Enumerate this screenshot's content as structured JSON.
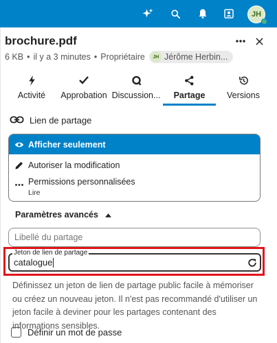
{
  "header": {
    "avatar_initials": "JH",
    "icons": [
      "sparkle-icon",
      "search-icon",
      "bell-icon",
      "contacts-icon"
    ]
  },
  "file": {
    "name": "brochure.pdf",
    "size": "6 KB",
    "modified": "il y a 3 minutes",
    "role": "Propriétaire",
    "owner_initials": "JH",
    "owner_name": "Jérôme Herbin..."
  },
  "tabs": [
    {
      "label": "Activité",
      "icon": "bolt-icon",
      "active": false
    },
    {
      "label": "Approbation",
      "icon": "check-icon",
      "active": false
    },
    {
      "label": "Discussion...",
      "icon": "chat-icon",
      "active": false
    },
    {
      "label": "Partage",
      "icon": "share-icon",
      "active": true
    },
    {
      "label": "Versions",
      "icon": "history-icon",
      "active": false
    }
  ],
  "share_link": {
    "heading": "Lien de partage",
    "options": {
      "view_only": "Afficher seulement",
      "allow_edit": "Autoriser la modification",
      "custom_perm": "Permissions personnalisées",
      "custom_perm_sub": "Lire"
    }
  },
  "advanced": {
    "heading": "Paramètres avancés",
    "label_placeholder": "Libellé du partage",
    "token_label": "Jeton de lien de partage",
    "token_value": "catalogue",
    "help_text": "Définissez un jeton de lien de partage public facile à mémoriser ou créez un nouveau jeton. Il n'est pas recommandé d'utiliser un jeton facile à deviner pour les partages contenant des informations sensibles.",
    "password_label": "Définir un mot de passe"
  },
  "colors": {
    "primary": "#0082c9",
    "highlight": "#e0141b"
  }
}
